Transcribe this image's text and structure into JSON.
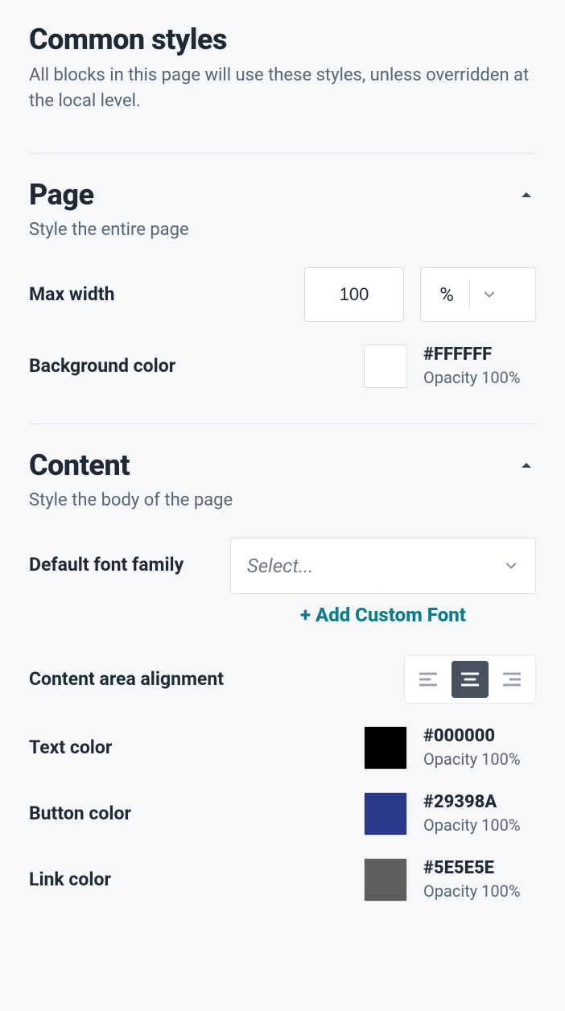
{
  "header": {
    "title": "Common styles",
    "desc": "All blocks in this page will use these styles, unless overridden at the local level."
  },
  "page_section": {
    "title": "Page",
    "desc": "Style the entire page",
    "max_width": {
      "label": "Max width",
      "value": "100",
      "unit": "%"
    },
    "background": {
      "label": "Background color",
      "hex": "#FFFFFF",
      "opacity": "Opacity 100%",
      "swatch": "#FFFFFF"
    }
  },
  "content_section": {
    "title": "Content",
    "desc": "Style the body of the page",
    "font_family": {
      "label": "Default font family",
      "placeholder": "Select...",
      "add_label": "+ Add Custom Font"
    },
    "alignment": {
      "label": "Content area alignment"
    },
    "text_color": {
      "label": "Text color",
      "hex": "#000000",
      "opacity": "Opacity 100%",
      "swatch": "#000000"
    },
    "button_color": {
      "label": "Button color",
      "hex": "#29398A",
      "opacity": "Opacity 100%",
      "swatch": "#29398A"
    },
    "link_color": {
      "label": "Link color",
      "hex": "#5E5E5E",
      "opacity": "Opacity 100%",
      "swatch": "#5E5E5E"
    }
  }
}
